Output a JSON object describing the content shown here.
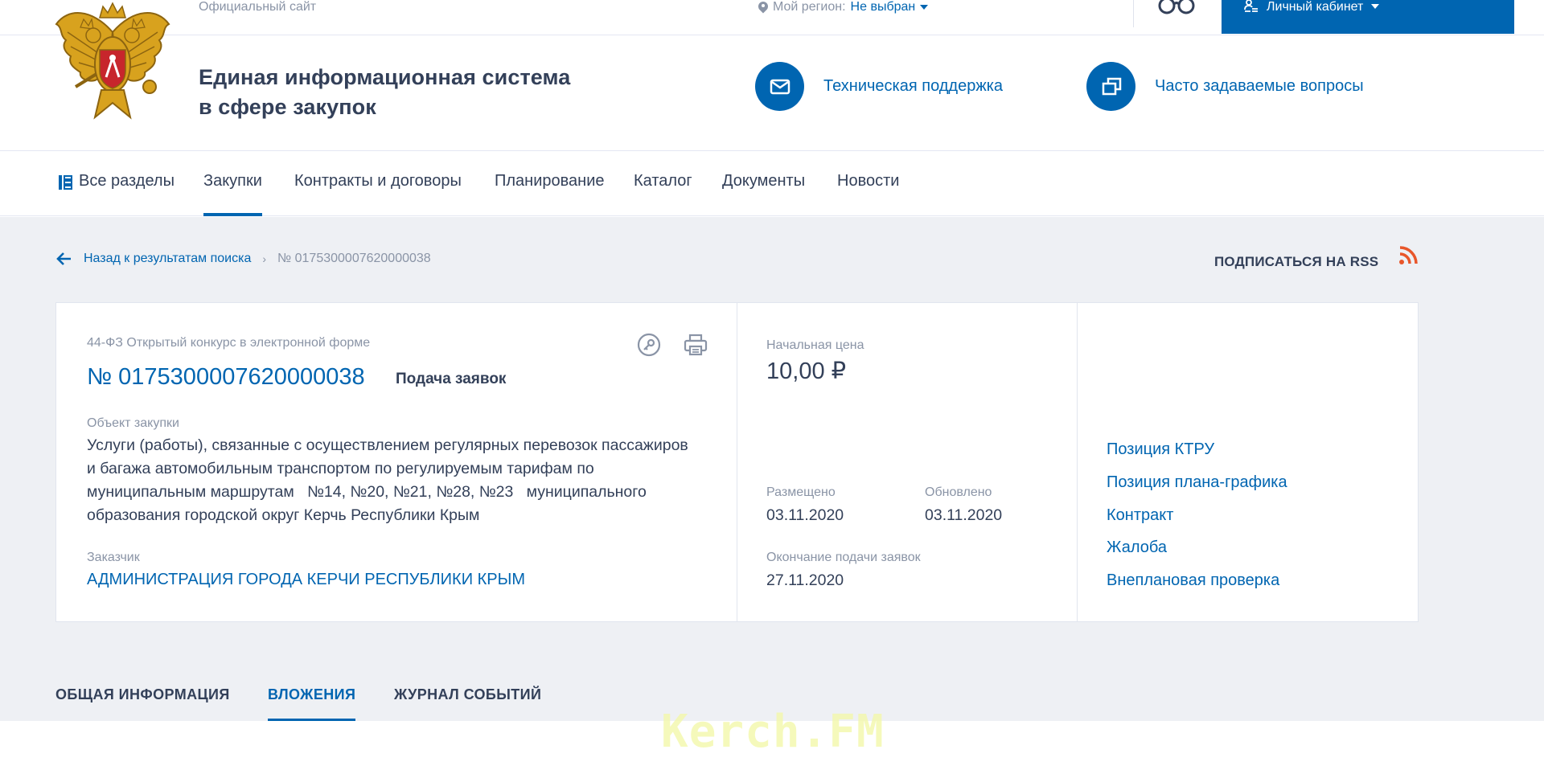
{
  "topbar": {
    "official_site": "Официальный сайт",
    "region_label": "Мой регион:",
    "region_value": "Не выбран",
    "cabinet_label": "Личный кабинет"
  },
  "header": {
    "title_line1": "Единая информационная система",
    "title_line2": "в сфере закупок",
    "support_label": "Техническая поддержка",
    "faq_label": "Часто задаваемые вопросы"
  },
  "nav": {
    "items": [
      {
        "label": "Все разделы"
      },
      {
        "label": "Закупки",
        "active": true
      },
      {
        "label": "Контракты и договоры"
      },
      {
        "label": "Планирование"
      },
      {
        "label": "Каталог"
      },
      {
        "label": "Документы"
      },
      {
        "label": "Новости"
      }
    ]
  },
  "breadcrumb": {
    "back_label": "Назад к результатам поиска",
    "current": "№ 0175300007620000038"
  },
  "rss_label": "ПОДПИСАТЬСЯ НА RSS",
  "purchase": {
    "law_type": "44-ФЗ Открытый конкурс в электронной форме",
    "number": "№ 0175300007620000038",
    "stage": "Подача заявок",
    "object_label": "Объект закупки",
    "object_lines": [
      "Услуги (работы), связанные с осуществлением регулярных перевозок пассажиров",
      "и багажа автомобильным транспортом по регулируемым тарифам по",
      "муниципальным маршрутам   №14, №20, №21, №28, №23   муниципального",
      "образования городской округ Керчь Республики Крым"
    ],
    "customer_label": "Заказчик",
    "customer": "АДМИНИСТРАЦИЯ ГОРОДА КЕРЧИ РЕСПУБЛИКИ КРЫМ",
    "price_label": "Начальная цена",
    "price": "10,00 ₽",
    "posted_label": "Размещено",
    "posted": "03.11.2020",
    "updated_label": "Обновлено",
    "updated": "03.11.2020",
    "deadline_label": "Окончание подачи заявок",
    "deadline": "27.11.2020",
    "links": [
      "Позиция КТРУ",
      "Позиция плана-графика",
      "Контракт",
      "Жалоба",
      "Внеплановая проверка"
    ]
  },
  "tabs": [
    {
      "label": "ОБЩАЯ ИНФОРМАЦИЯ"
    },
    {
      "label": "ВЛОЖЕНИЯ",
      "active": true
    },
    {
      "label": "ЖУРНАЛ СОБЫТИЙ"
    }
  ],
  "watermark": "Kerch.FM",
  "colors": {
    "primary": "#0065b1",
    "text": "#334059",
    "muted": "#8a94a6",
    "background_grey": "#eef0f4",
    "rss": "#e8562a"
  }
}
